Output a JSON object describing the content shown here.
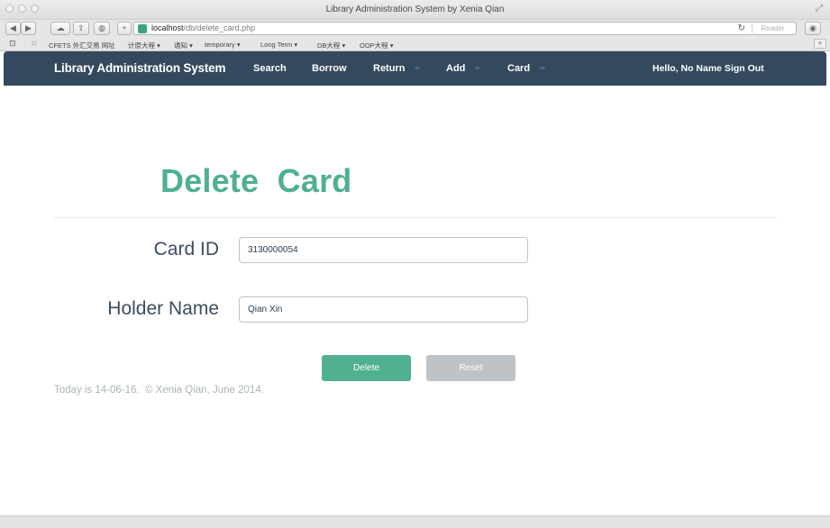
{
  "window": {
    "title": "Library Administration System by Xenia Qian"
  },
  "browser": {
    "url_host": "localhost",
    "url_path": "/db/delete_card.php",
    "reader_label": "Reader",
    "bookmarks": [
      "CFETS 外汇交易 网址",
      "计原大程 ▾",
      "通知 ▾",
      "temporary ▾",
      "Long Term ▾",
      "DB大程 ▾",
      "OOP大程 ▾"
    ]
  },
  "navbar": {
    "brand": "Library Administration System",
    "items": [
      {
        "label": "Search",
        "dropdown": false
      },
      {
        "label": "Borrow",
        "dropdown": false
      },
      {
        "label": "Return",
        "dropdown": true
      },
      {
        "label": "Add",
        "dropdown": true
      },
      {
        "label": "Card",
        "dropdown": true
      }
    ],
    "user_text": "Hello, No Name Sign Out",
    "bg_color": "#34495e"
  },
  "page": {
    "title": "Delete  Card",
    "title_color": "#4fb08f"
  },
  "form": {
    "card_id_label": "Card ID",
    "card_id_value": "3130000054",
    "holder_name_label": "Holder Name",
    "holder_name_value": "Qian Xin",
    "delete_label": "Delete",
    "reset_label": "Reset",
    "delete_color": "#52b092",
    "reset_color": "#bdc3c7"
  },
  "footer": {
    "text": "Today is 14-06-16.  © Xenia Qian, June 2014."
  }
}
